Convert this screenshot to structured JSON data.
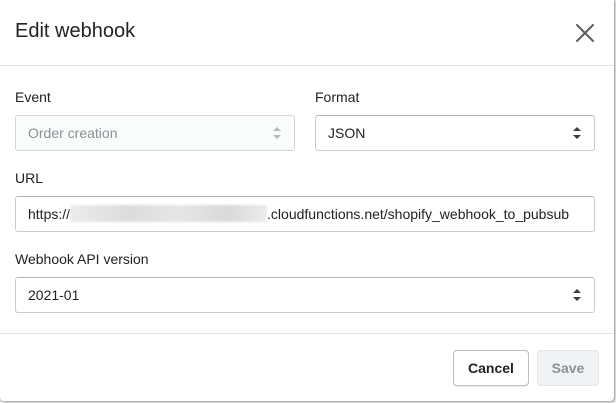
{
  "modal": {
    "title": "Edit webhook",
    "close_icon": "close-icon"
  },
  "form": {
    "event": {
      "label": "Event",
      "value": "Order creation",
      "disabled": true,
      "icon": "select-caret-icon"
    },
    "format": {
      "label": "Format",
      "value": "JSON",
      "icon": "select-caret-icon"
    },
    "url": {
      "label": "URL",
      "prefix": "https://",
      "suffix": ".cloudfunctions.net/shopify_webhook_to_pubsub"
    },
    "api_version": {
      "label": "Webhook API version",
      "value": "2021-01",
      "icon": "select-caret-icon"
    }
  },
  "footer": {
    "cancel_label": "Cancel",
    "save_label": "Save"
  },
  "colors": {
    "border": "#c9cccf",
    "text": "#202223",
    "disabled_text": "#8c9196",
    "divider": "#e1e3e5"
  }
}
